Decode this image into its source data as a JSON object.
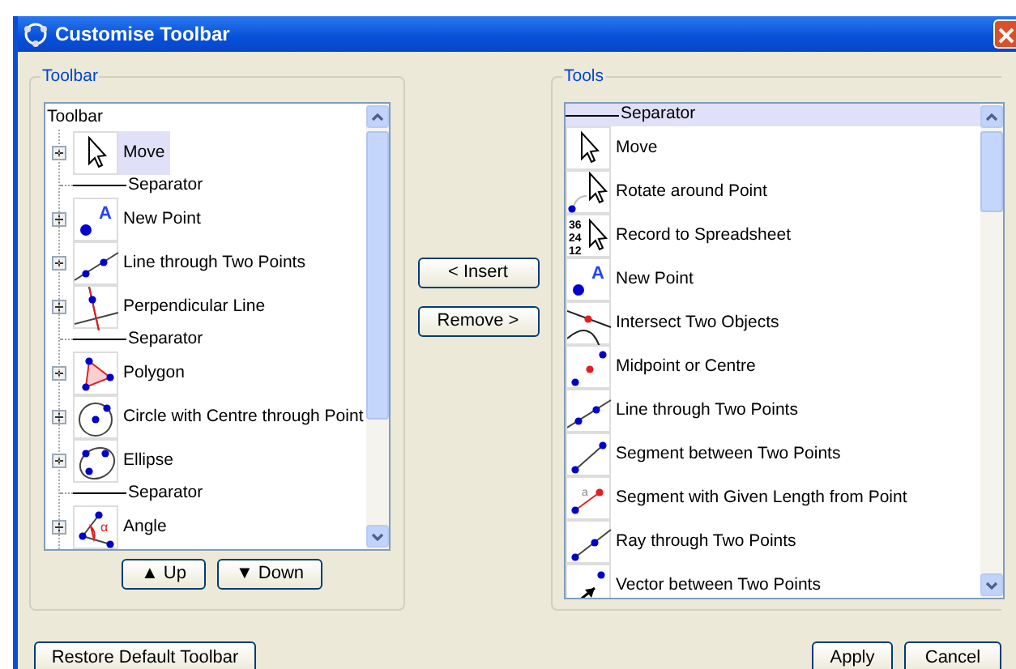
{
  "window": {
    "title": "Customise Toolbar"
  },
  "toolbar_group": {
    "legend": "Toolbar",
    "root_label": "Toolbar",
    "items": [
      {
        "kind": "tool",
        "label": "Move",
        "selected": true,
        "expanded": false
      },
      {
        "kind": "separator",
        "label": "Separator"
      },
      {
        "kind": "tool",
        "label": "New Point",
        "selected": false,
        "expanded": false,
        "icon_text": "A"
      },
      {
        "kind": "tool",
        "label": "Line through Two Points",
        "selected": false,
        "expanded": false
      },
      {
        "kind": "tool",
        "label": "Perpendicular Line",
        "selected": false,
        "expanded": false
      },
      {
        "kind": "separator",
        "label": "Separator"
      },
      {
        "kind": "tool",
        "label": "Polygon",
        "selected": false,
        "expanded": false
      },
      {
        "kind": "tool",
        "label": "Circle with Centre through Point",
        "selected": false,
        "expanded": false
      },
      {
        "kind": "tool",
        "label": "Ellipse",
        "selected": false,
        "expanded": false
      },
      {
        "kind": "separator",
        "label": "Separator"
      },
      {
        "kind": "tool",
        "label": "Angle",
        "selected": false,
        "expanded": false,
        "icon_text": "α"
      }
    ],
    "buttons": [
      "▲ Up",
      "▼ Down"
    ]
  },
  "middle_buttons": [
    "< Insert",
    "Remove >"
  ],
  "tools_group": {
    "legend": "Tools",
    "items": [
      {
        "kind": "separator",
        "label": "Separator",
        "selected": true
      },
      {
        "kind": "tool",
        "label": "Move",
        "selected": false
      },
      {
        "kind": "tool",
        "label": "Rotate around Point",
        "selected": false
      },
      {
        "kind": "tool",
        "label": "Record to Spreadsheet",
        "selected": false,
        "icon_text": "36 24 12"
      },
      {
        "kind": "tool",
        "label": "New Point",
        "selected": false,
        "icon_text": "A"
      },
      {
        "kind": "tool",
        "label": "Intersect Two Objects",
        "selected": false
      },
      {
        "kind": "tool",
        "label": "Midpoint or Centre",
        "selected": false
      },
      {
        "kind": "tool",
        "label": "Line through Two Points",
        "selected": false
      },
      {
        "kind": "tool",
        "label": "Segment between Two Points",
        "selected": false
      },
      {
        "kind": "tool",
        "label": "Segment with Given Length from Point",
        "selected": false,
        "icon_text": "a"
      },
      {
        "kind": "tool",
        "label": "Ray through Two Points",
        "selected": false
      },
      {
        "kind": "tool",
        "label": "Vector between Two Points",
        "selected": false
      }
    ]
  },
  "footer": {
    "restore_button": "Restore Default Toolbar",
    "buttons": [
      "Apply",
      "Cancel"
    ]
  }
}
